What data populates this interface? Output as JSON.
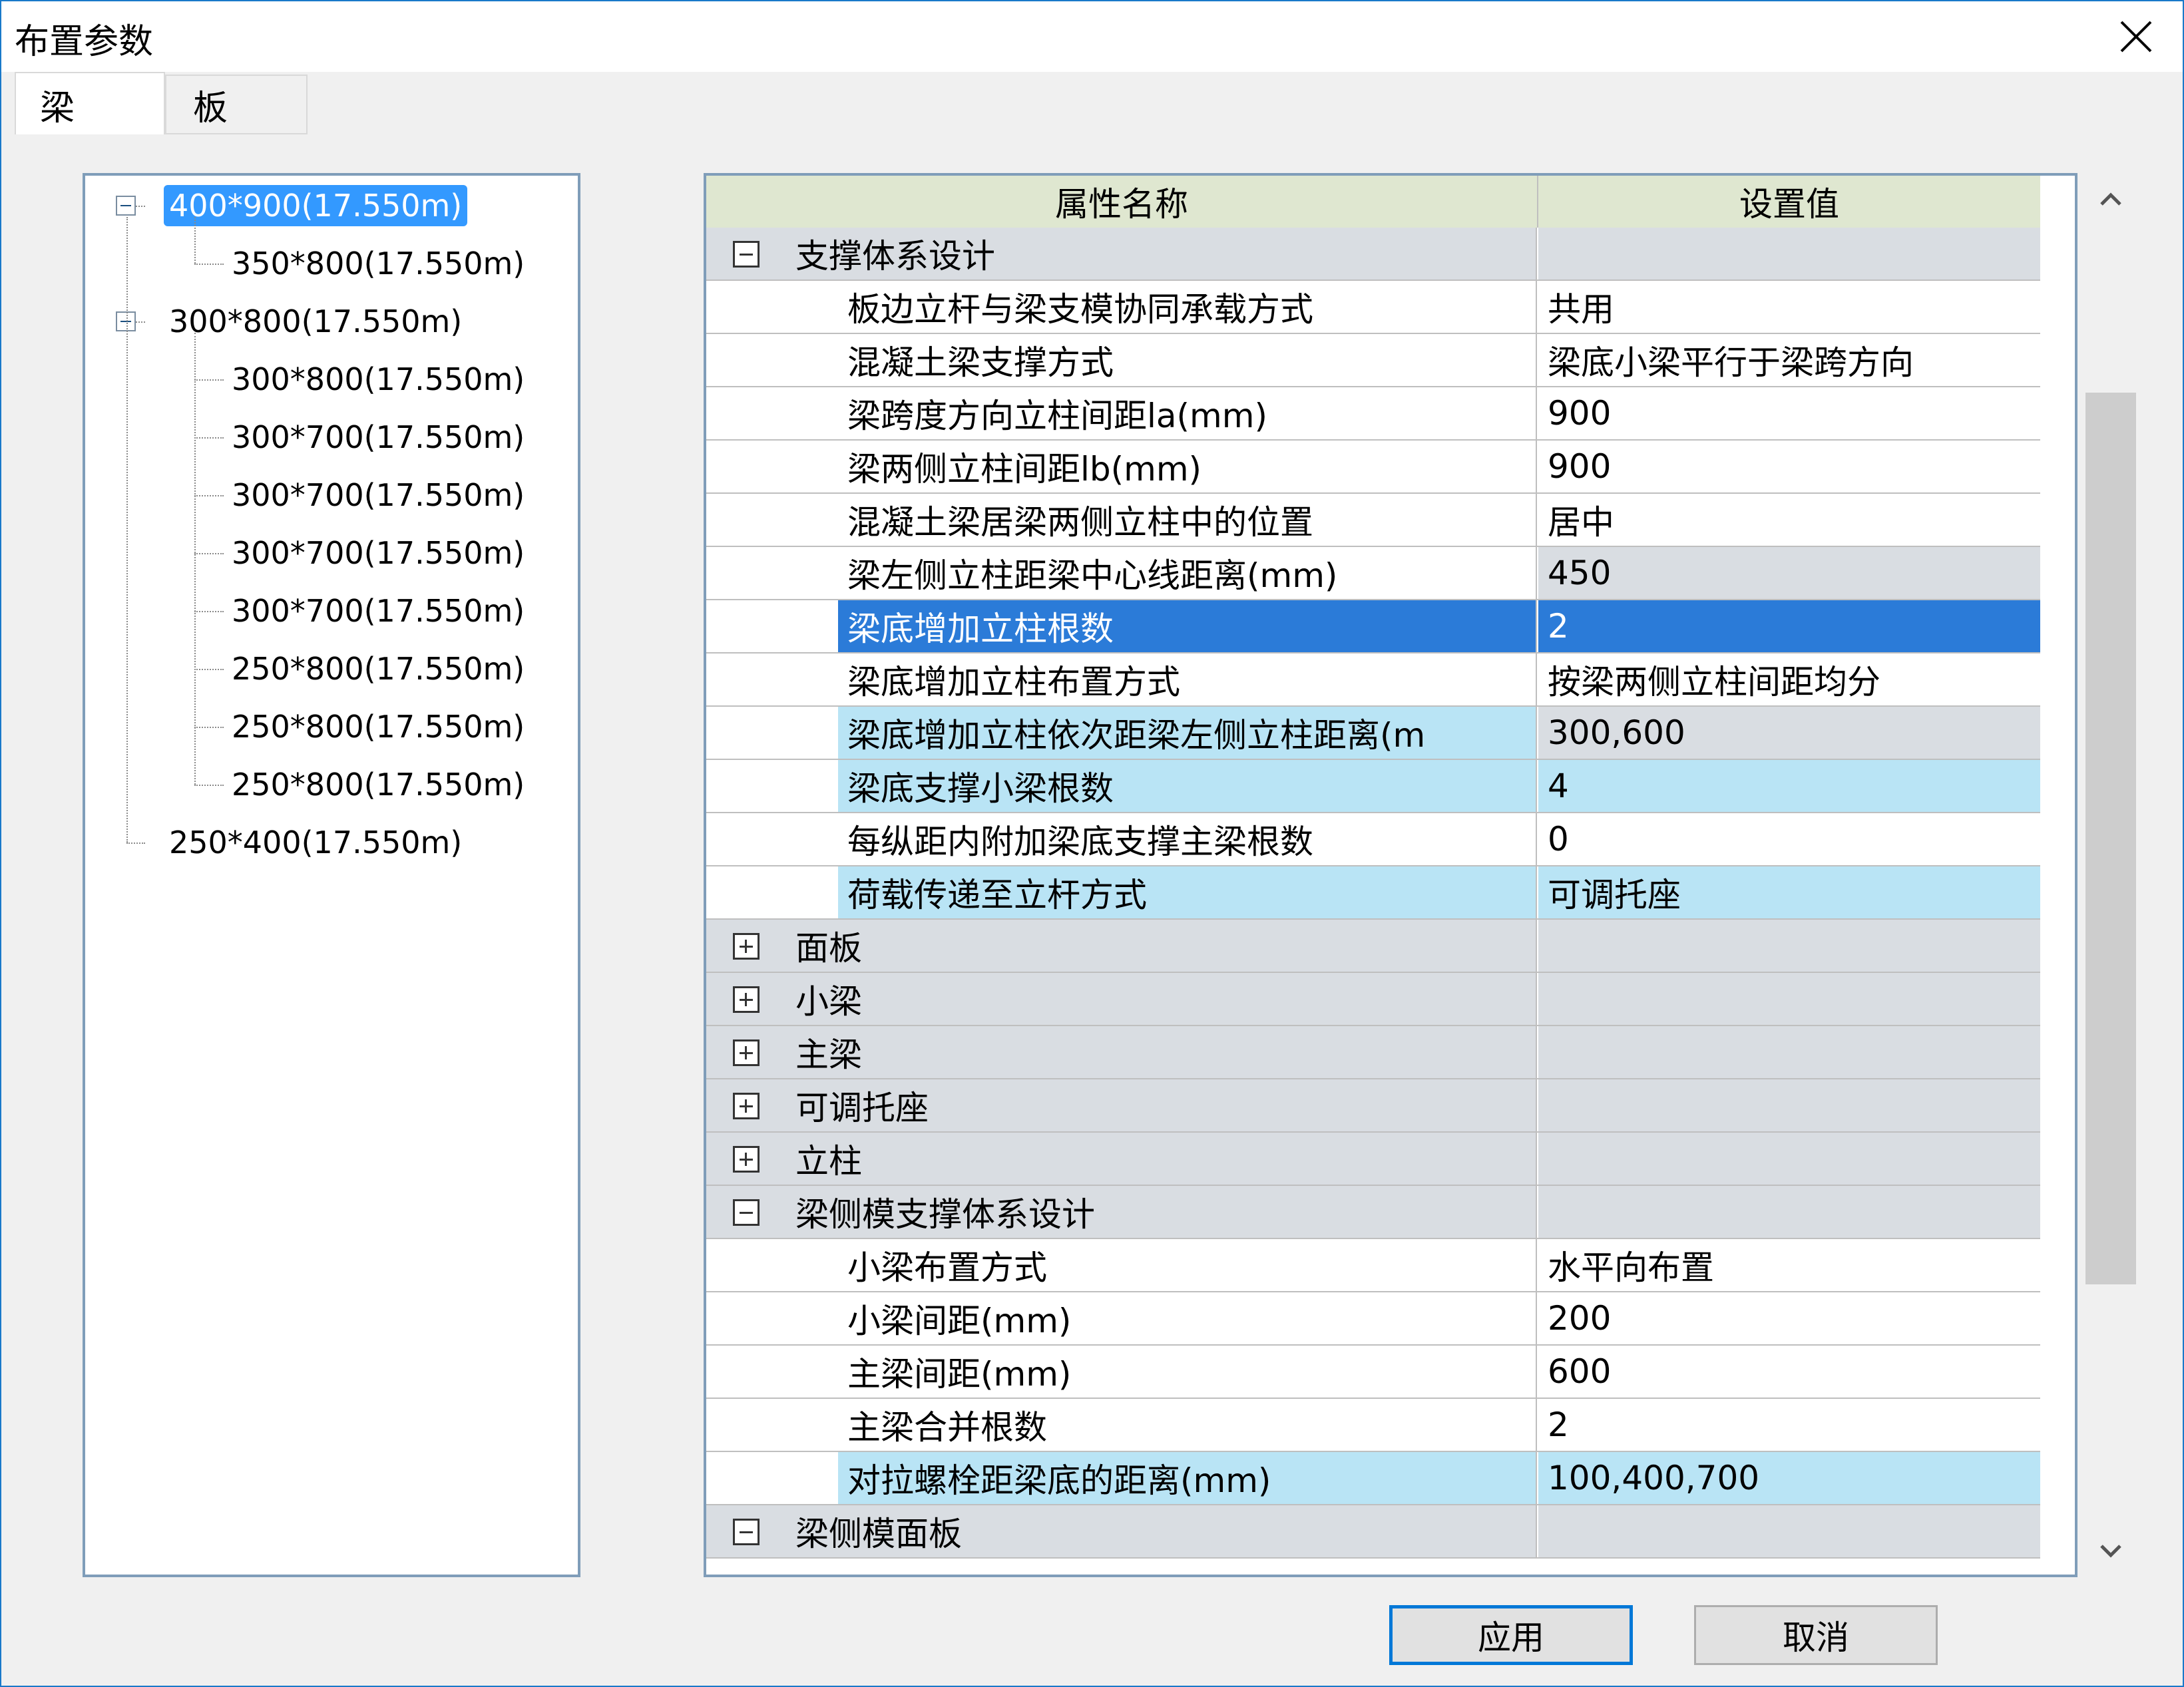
{
  "window": {
    "title": "布置参数"
  },
  "tabs": [
    {
      "label": "梁"
    },
    {
      "label": "板"
    }
  ],
  "tree": {
    "groups": [
      {
        "label": "400*900(17.550m)",
        "selected": true,
        "children": [
          "350*800(17.550m)"
        ]
      },
      {
        "label": "300*800(17.550m)",
        "selected": false,
        "children": [
          "300*800(17.550m)",
          "300*700(17.550m)",
          "300*700(17.550m)",
          "300*700(17.550m)",
          "300*700(17.550m)",
          "250*800(17.550m)",
          "250*800(17.550m)",
          "250*800(17.550m)"
        ]
      },
      {
        "label": "250*400(17.550m)",
        "selected": false,
        "children": []
      }
    ]
  },
  "grid": {
    "header": {
      "name": "属性名称",
      "value": "设置值"
    },
    "rows": [
      {
        "type": "category",
        "expanded": true,
        "name": "支撑体系设计",
        "value": ""
      },
      {
        "type": "prop",
        "name": "板边立杆与梁支模协同承载方式",
        "value": "共用",
        "style": ""
      },
      {
        "type": "prop",
        "name": "混凝土梁支撑方式",
        "value": "梁底小梁平行于梁跨方向",
        "style": ""
      },
      {
        "type": "prop",
        "name": "梁跨度方向立柱间距la(mm)",
        "value": "900",
        "style": ""
      },
      {
        "type": "prop",
        "name": "梁两侧立柱间距lb(mm)",
        "value": "900",
        "style": ""
      },
      {
        "type": "prop",
        "name": "混凝土梁居梁两侧立柱中的位置",
        "value": "居中",
        "style": ""
      },
      {
        "type": "prop",
        "name": "梁左侧立柱距梁中心线距离(mm)",
        "value": "450",
        "style": "val-gray"
      },
      {
        "type": "prop",
        "name": "梁底增加立柱根数",
        "value": "2",
        "style": "hl-select"
      },
      {
        "type": "prop",
        "name": "梁底增加立柱布置方式",
        "value": "按梁两侧立柱间距均分",
        "style": ""
      },
      {
        "type": "prop",
        "name": "梁底增加立柱依次距梁左侧立柱距离(m",
        "value": "300,600",
        "style": "hl-blue-name-gray-val"
      },
      {
        "type": "prop",
        "name": "梁底支撑小梁根数",
        "value": "4",
        "style": "hl-blue"
      },
      {
        "type": "prop",
        "name": "每纵距内附加梁底支撑主梁根数",
        "value": "0",
        "style": ""
      },
      {
        "type": "prop",
        "name": "荷载传递至立杆方式",
        "value": "可调托座",
        "style": "hl-blue"
      },
      {
        "type": "category",
        "expanded": false,
        "name": "面板",
        "value": ""
      },
      {
        "type": "category",
        "expanded": false,
        "name": "小梁",
        "value": ""
      },
      {
        "type": "category",
        "expanded": false,
        "name": "主梁",
        "value": ""
      },
      {
        "type": "category",
        "expanded": false,
        "name": "可调托座",
        "value": ""
      },
      {
        "type": "category",
        "expanded": false,
        "name": "立柱",
        "value": ""
      },
      {
        "type": "category",
        "expanded": true,
        "name": "梁侧模支撑体系设计",
        "value": ""
      },
      {
        "type": "prop",
        "name": "小梁布置方式",
        "value": "水平向布置",
        "style": ""
      },
      {
        "type": "prop",
        "name": "小梁间距(mm)",
        "value": "200",
        "style": ""
      },
      {
        "type": "prop",
        "name": "主梁间距(mm)",
        "value": "600",
        "style": ""
      },
      {
        "type": "prop",
        "name": "主梁合并根数",
        "value": "2",
        "style": ""
      },
      {
        "type": "prop",
        "name": "对拉螺栓距梁底的距离(mm)",
        "value": "100,400,700",
        "style": "hl-blue"
      },
      {
        "type": "category",
        "expanded": true,
        "name": "梁侧模面板",
        "value": ""
      }
    ]
  },
  "buttons": {
    "apply": "应用",
    "cancel": "取消"
  },
  "icons": {
    "close": "close-icon",
    "scroll_up": "chevron-up-icon",
    "scroll_down": "chevron-down-icon"
  },
  "colors": {
    "accent": "#0078d7",
    "selection": "#2b7bd8",
    "highlight": "#b9e4f5",
    "category": "#d9dde2"
  }
}
